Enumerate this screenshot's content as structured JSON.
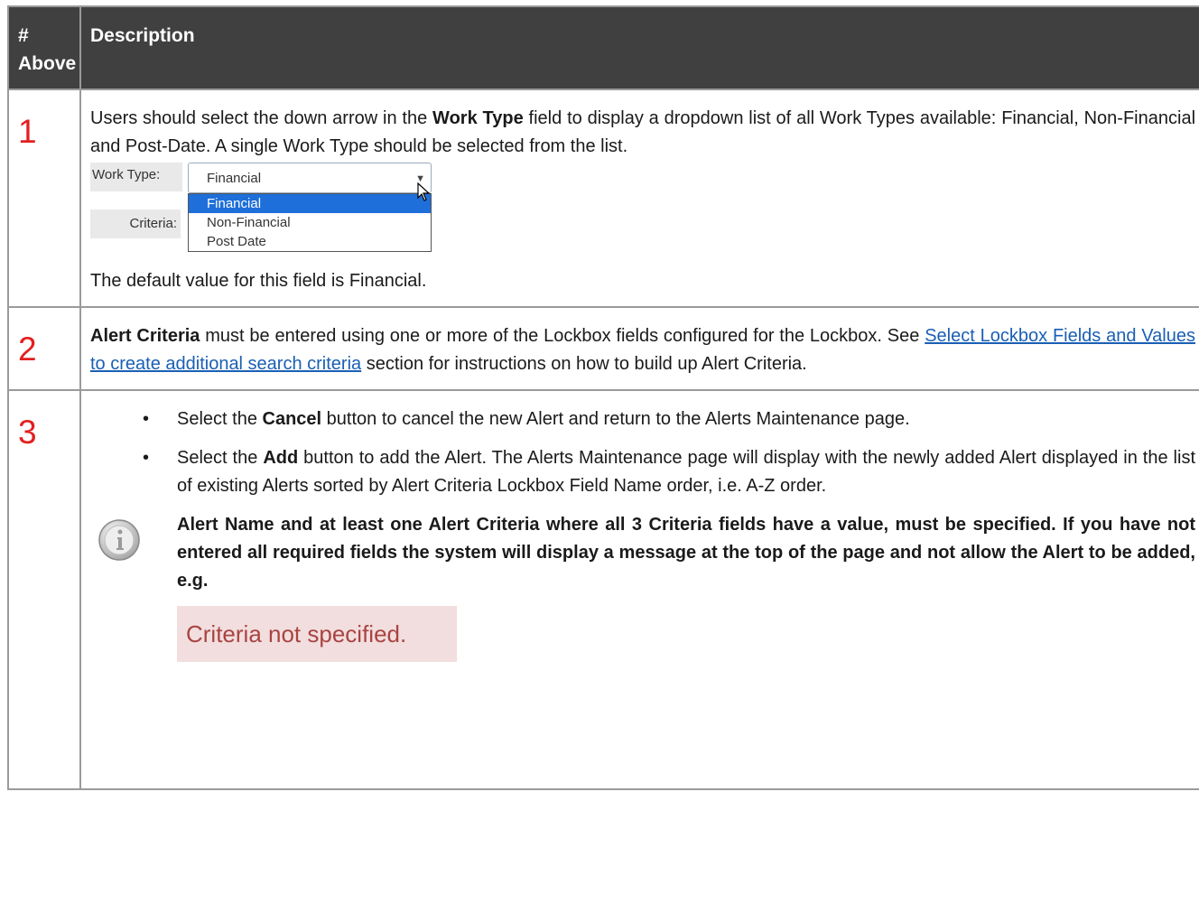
{
  "header": {
    "col_num": "# Above",
    "col_desc": "Description"
  },
  "row1": {
    "num": "1",
    "intro_pre": "Users should select the down arrow in the ",
    "intro_bold": "Work Type",
    "intro_post": " field to display a dropdown list of all Work Types available: Financial, Non-Financial and Post-Date. A single Work Type should be selected from the list.",
    "widget": {
      "work_type_label": "Work Type:",
      "criteria_label": "Criteria:",
      "selected_value": "Financial",
      "options": [
        "Financial",
        "Non-Financial",
        "Post Date"
      ]
    },
    "footer": "The default value for this field is Financial."
  },
  "row2": {
    "num": "2",
    "bold": "Alert Criteria",
    "text1": " must be entered using one or more of the Lockbox fields configured for the Lockbox. See ",
    "link": "Select Lockbox Fields and Values to create additional search criteria",
    "text2": " section for instructions on how to build up Alert Criteria."
  },
  "row3": {
    "num": "3",
    "b1_pre": "Select the ",
    "b1_bold": "Cancel",
    "b1_post": " button to cancel the new Alert and return to the Alerts Maintenance page.",
    "b2_pre": "Select the ",
    "b2_bold": "Add",
    "b2_post": " button to add the Alert. The Alerts Maintenance page will display with the newly added Alert displayed in the list of existing Alerts sorted by Alert Criteria Lockbox Field Name order, i.e. A-Z order.",
    "note": "Alert Name and at least one Alert Criteria where all 3 Criteria fields have a value, must be specified. If you have not entered all required fields the system will display a message at the top of the page and not allow the Alert to be added, e.g.",
    "error_message": "Criteria not specified."
  },
  "colors": {
    "header_bg": "#404040",
    "number": "#e31f1f",
    "link": "#1a5fb4",
    "error_bg": "#f2dede",
    "error_text": "#a94442"
  }
}
